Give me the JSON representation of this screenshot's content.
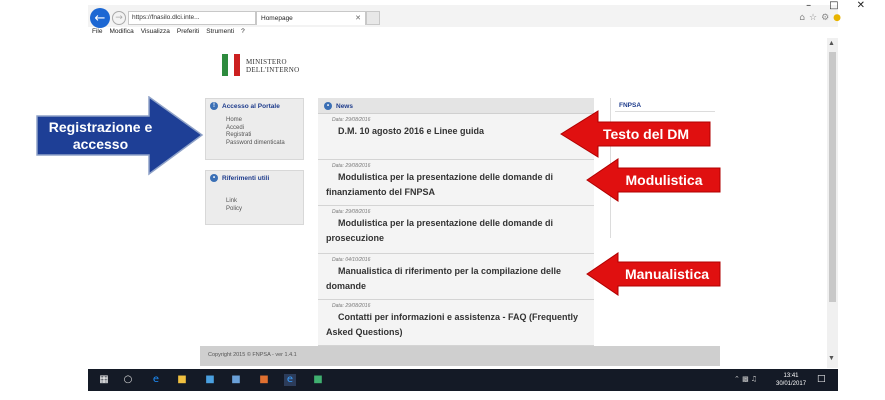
{
  "browser": {
    "address": "https://fnasilo.dlci.inte...",
    "address_suffix": "⌕ ▾ 🔒 ↻",
    "tab_label": "Homepage",
    "menu": [
      "File",
      "Modifica",
      "Visualizza",
      "Preferiti",
      "Strumenti",
      "?"
    ]
  },
  "logo": {
    "line1": "MINISTERO",
    "line2": "DELL'INTERNO"
  },
  "access_box": {
    "title": "Accesso al Portale",
    "links": [
      "Home",
      "Accedi",
      "Registrati",
      "Password dimenticata"
    ]
  },
  "ref_box": {
    "title": "Riferimenti utili",
    "links": [
      "Link",
      "Policy"
    ]
  },
  "news": {
    "title": "News",
    "items": [
      {
        "date": "Data: 29/08/2016",
        "text": "D.M. 10 agosto 2016 e Linee guida"
      },
      {
        "date": "Data: 29/08/2016",
        "text": "Modulistica per la presentazione delle domande di finanziamento del FNPSA"
      },
      {
        "date": "Data: 29/08/2016",
        "text": "Modulistica per la presentazione delle domande di prosecuzione"
      },
      {
        "date": "Data: 04/10/2016",
        "text": "Manualistica di riferimento per la compilazione delle domande"
      },
      {
        "date": "Data: 29/08/2016",
        "text": "Contatti per informazioni e assistenza - FAQ (Frequently Asked Questions)"
      }
    ]
  },
  "right_col": {
    "title": "FNPSA"
  },
  "footer": {
    "copyright": "Copyright 2015 © FNPSA - ver 1.4.1"
  },
  "callouts": {
    "blue": "Registrazione e accesso",
    "red1": "Testo del DM",
    "red2": "Modulistica",
    "red3": "Manualistica"
  },
  "taskbar": {
    "time": "13:41",
    "date": "30/01/2017"
  },
  "colors": {
    "callout_blue": "#1e3f96",
    "callout_red": "#e01010",
    "link_blue": "#1e3c8c"
  }
}
